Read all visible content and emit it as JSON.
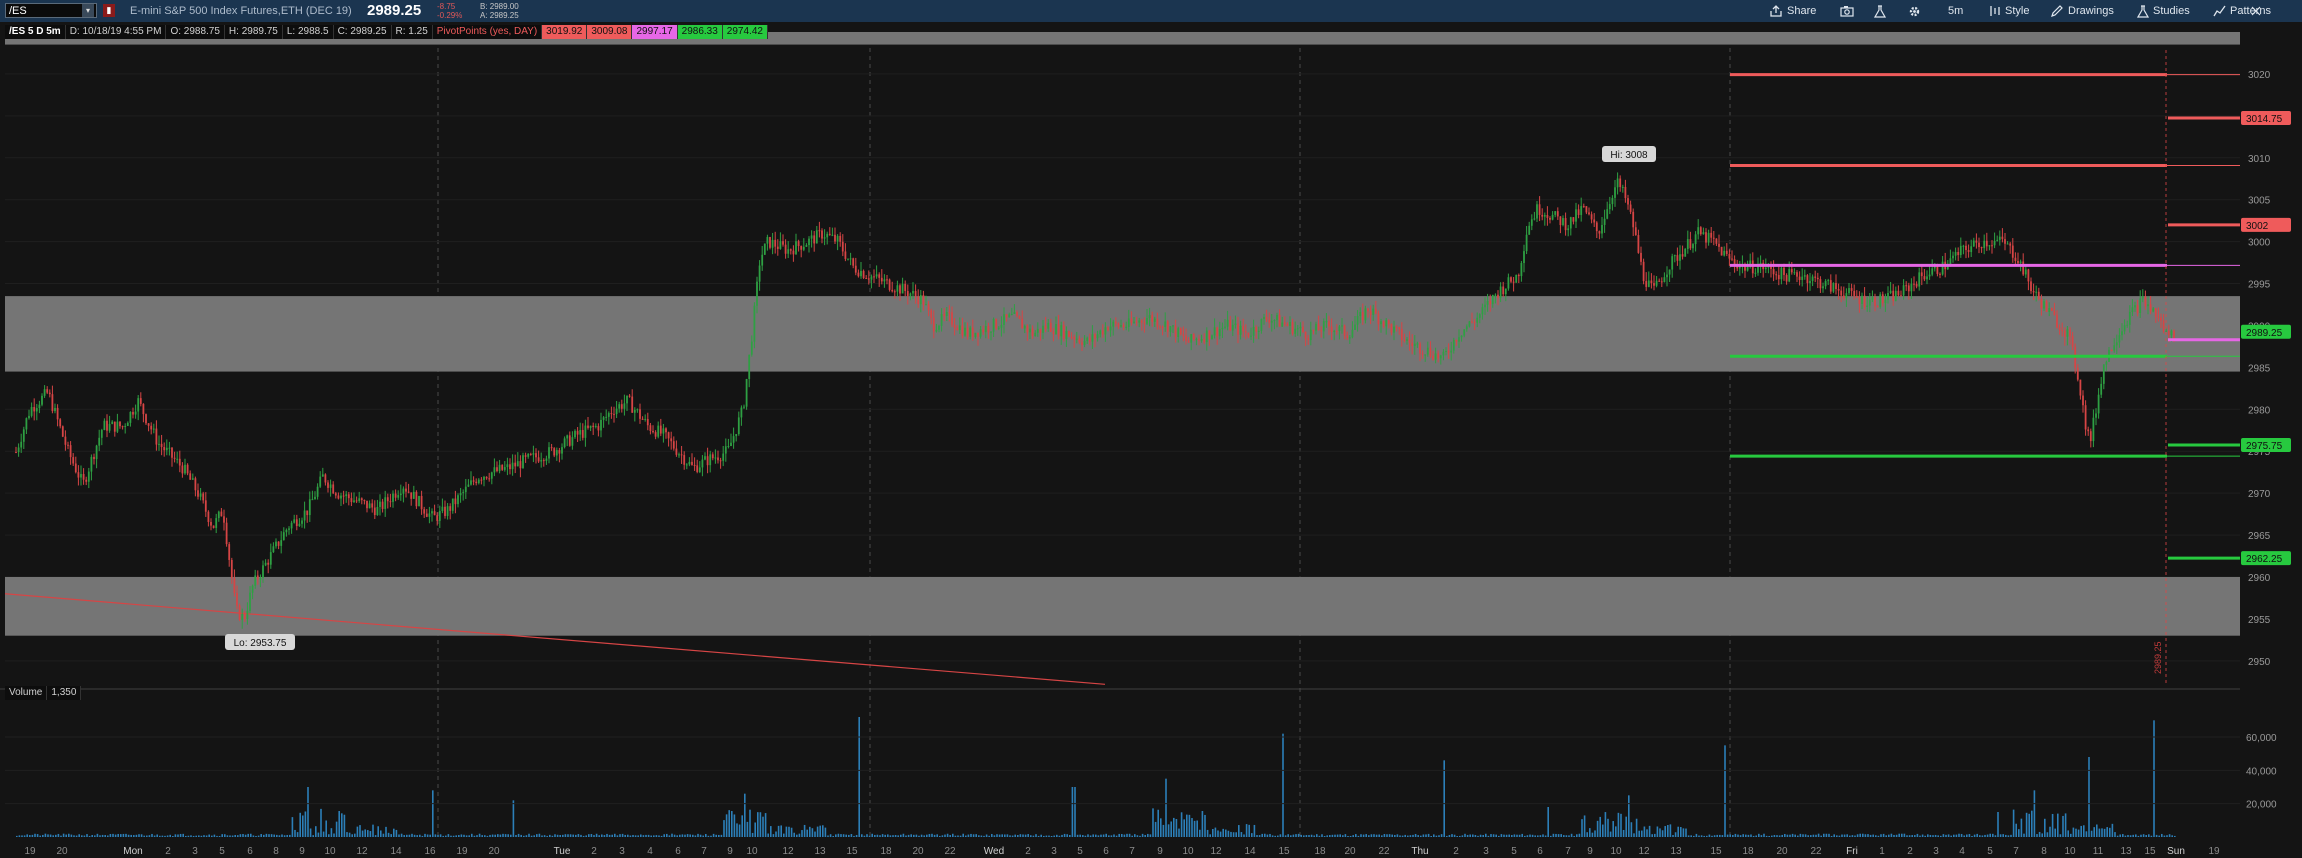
{
  "toolbar": {
    "symbol": "/ES",
    "description": "E-mini S&P 500 Index Futures,ETH (DEC 19)",
    "last_price": "2989.25",
    "change": "-8.75",
    "change_pct": "-0.29%",
    "bid": "B: 2989.00",
    "ask": "A: 2989.25",
    "share": "Share",
    "interval": "5m",
    "style": "Style",
    "drawings": "Drawings",
    "studies": "Studies",
    "patterns": "Patterns"
  },
  "info_bar": {
    "chart_label": "/ES 5 D 5m",
    "date": "D: 10/18/19 4:55 PM",
    "open": "O: 2988.75",
    "high": "H: 2989.75",
    "low": "L: 2988.5",
    "close": "C: 2989.25",
    "range": "R: 1.25",
    "study_name": "PivotPoints (yes, DAY)",
    "pivot_values": [
      "3019.92",
      "3009.08",
      "2997.17",
      "2986.33",
      "2974.42"
    ]
  },
  "annotations": {
    "high_label": "Hi: 3008",
    "low_label": "Lo: 2953.75",
    "vertical_label": "2989.25"
  },
  "volume_pane": {
    "label": "Volume",
    "value": "1,350",
    "axis_ticks": [
      "60,000",
      "40,000",
      "20,000"
    ]
  },
  "colors": {
    "resistance": "#ef5b5b",
    "pivot": "#e667e6",
    "support": "#27c93f",
    "candle_up": "#2ea043",
    "candle_down": "#d64545",
    "volume": "#2c7fb8",
    "zone": "#757575"
  },
  "chart_data": {
    "type": "candlestick",
    "y_axis": {
      "range": [
        2947,
        3025
      ],
      "ticks": [
        3020,
        3015,
        3010,
        3005,
        3000,
        2995,
        2990,
        2985,
        2980,
        2975,
        2970,
        2965,
        2960,
        2955,
        2950
      ]
    },
    "price_badges": [
      {
        "value": "3014.75",
        "kind": "resistance"
      },
      {
        "value": "3002",
        "kind": "resistance"
      },
      {
        "value": "2989.25",
        "kind": "last"
      },
      {
        "value": "2975.75",
        "kind": "support"
      },
      {
        "value": "2962.25",
        "kind": "support"
      }
    ],
    "pivot_lines": [
      {
        "price": 3019.92,
        "kind": "resistance"
      },
      {
        "price": 3009.08,
        "kind": "resistance"
      },
      {
        "price": 2997.17,
        "kind": "pivot"
      },
      {
        "price": 2986.33,
        "kind": "support"
      },
      {
        "price": 2974.42,
        "kind": "support"
      }
    ],
    "zones": [
      {
        "low": 2984.5,
        "high": 2993.5
      },
      {
        "low": 2953,
        "high": 2960
      }
    ],
    "x_axis_labels": [
      "19",
      "20",
      "Mon",
      "2",
      "3",
      "5",
      "6",
      "8",
      "9",
      "10",
      "12",
      "14",
      "16",
      "19",
      "20",
      "Tue",
      "2",
      "3",
      "4",
      "6",
      "7",
      "9",
      "10",
      "12",
      "13",
      "15",
      "18",
      "20",
      "22",
      "Wed",
      "2",
      "3",
      "5",
      "6",
      "7",
      "9",
      "10",
      "12",
      "14",
      "15",
      "18",
      "20",
      "22",
      "Thu",
      "2",
      "3",
      "5",
      "6",
      "7",
      "9",
      "10",
      "12",
      "13",
      "15",
      "18",
      "20",
      "22",
      "Fri",
      "1",
      "2",
      "3",
      "4",
      "5",
      "7",
      "8",
      "10",
      "11",
      "13",
      "15",
      "Sun",
      "19"
    ],
    "volume_axis": {
      "range": [
        0,
        75000
      ]
    },
    "price_path": [
      [
        0,
        2972
      ],
      [
        22,
        2980
      ],
      [
        40,
        2982
      ],
      [
        60,
        2975
      ],
      [
        75,
        2971
      ],
      [
        95,
        2978
      ],
      [
        115,
        2978
      ],
      [
        130,
        2981
      ],
      [
        150,
        2976
      ],
      [
        175,
        2973
      ],
      [
        190,
        2970
      ],
      [
        205,
        2966
      ],
      [
        215,
        2968
      ],
      [
        228,
        2956
      ],
      [
        236,
        2955
      ],
      [
        245,
        2959
      ],
      [
        260,
        2962
      ],
      [
        280,
        2966
      ],
      [
        300,
        2968
      ],
      [
        315,
        2972
      ],
      [
        330,
        2970
      ],
      [
        350,
        2969
      ],
      [
        370,
        2968
      ],
      [
        395,
        2971
      ],
      [
        425,
        2967
      ],
      [
        440,
        2968
      ],
      [
        470,
        2972
      ],
      [
        500,
        2973
      ],
      [
        520,
        2974
      ],
      [
        545,
        2975
      ],
      [
        570,
        2977
      ],
      [
        590,
        2978
      ],
      [
        605,
        2980
      ],
      [
        620,
        2981
      ],
      [
        640,
        2978
      ],
      [
        655,
        2977
      ],
      [
        670,
        2975
      ],
      [
        685,
        2973
      ],
      [
        700,
        2974
      ],
      [
        720,
        2975
      ],
      [
        735,
        2980
      ],
      [
        745,
        2990
      ],
      [
        752,
        2998
      ],
      [
        760,
        3000
      ],
      [
        780,
        2999
      ],
      [
        800,
        3000
      ],
      [
        815,
        3001
      ],
      [
        830,
        3000
      ],
      [
        845,
        2997
      ],
      [
        860,
        2996
      ],
      [
        880,
        2995
      ],
      [
        900,
        2994
      ],
      [
        915,
        2993
      ],
      [
        925,
        2990
      ],
      [
        940,
        2991
      ],
      [
        960,
        2989
      ],
      [
        985,
        2990
      ],
      [
        1005,
        2991
      ],
      [
        1025,
        2989
      ],
      [
        1040,
        2990
      ],
      [
        1060,
        2989
      ],
      [
        1080,
        2988
      ],
      [
        1100,
        2990
      ],
      [
        1120,
        2990
      ],
      [
        1140,
        2991
      ],
      [
        1160,
        2990
      ],
      [
        1180,
        2988
      ],
      [
        1200,
        2989
      ],
      [
        1220,
        2990
      ],
      [
        1240,
        2989
      ],
      [
        1260,
        2991
      ],
      [
        1280,
        2990
      ],
      [
        1300,
        2989
      ],
      [
        1320,
        2990
      ],
      [
        1340,
        2989
      ],
      [
        1360,
        2992
      ],
      [
        1380,
        2990
      ],
      [
        1400,
        2988
      ],
      [
        1420,
        2987
      ],
      [
        1435,
        2986
      ],
      [
        1450,
        2989
      ],
      [
        1470,
        2991
      ],
      [
        1490,
        2994
      ],
      [
        1510,
        2996
      ],
      [
        1520,
        3002
      ],
      [
        1530,
        3004
      ],
      [
        1545,
        3003
      ],
      [
        1560,
        3002
      ],
      [
        1575,
        3004
      ],
      [
        1590,
        3001
      ],
      [
        1605,
        3006
      ],
      [
        1610,
        3007
      ],
      [
        1618,
        3005
      ],
      [
        1625,
        3002
      ],
      [
        1635,
        2996
      ],
      [
        1645,
        2994
      ],
      [
        1660,
        2997
      ],
      [
        1675,
        2999
      ],
      [
        1690,
        3001
      ],
      [
        1705,
        3000
      ],
      [
        1720,
        2998
      ],
      [
        1735,
        2997
      ],
      [
        1755,
        2997
      ],
      [
        1775,
        2996
      ],
      [
        1795,
        2996
      ],
      [
        1815,
        2995
      ],
      [
        1835,
        2994
      ],
      [
        1855,
        2993
      ],
      [
        1875,
        2993
      ],
      [
        1895,
        2994
      ],
      [
        1915,
        2996
      ],
      [
        1935,
        2997
      ],
      [
        1955,
        2999
      ],
      [
        1975,
        3000
      ],
      [
        1995,
        3000
      ],
      [
        2010,
        2998
      ],
      [
        2025,
        2994
      ],
      [
        2045,
        2991
      ],
      [
        2060,
        2989
      ],
      [
        2070,
        2984
      ],
      [
        2078,
        2978
      ],
      [
        2082,
        2976
      ],
      [
        2088,
        2980
      ],
      [
        2095,
        2985
      ],
      [
        2105,
        2988
      ],
      [
        2120,
        2991
      ],
      [
        2135,
        2993
      ],
      [
        2150,
        2991
      ],
      [
        2158,
        2989
      ],
      [
        2168,
        2989
      ]
    ]
  }
}
